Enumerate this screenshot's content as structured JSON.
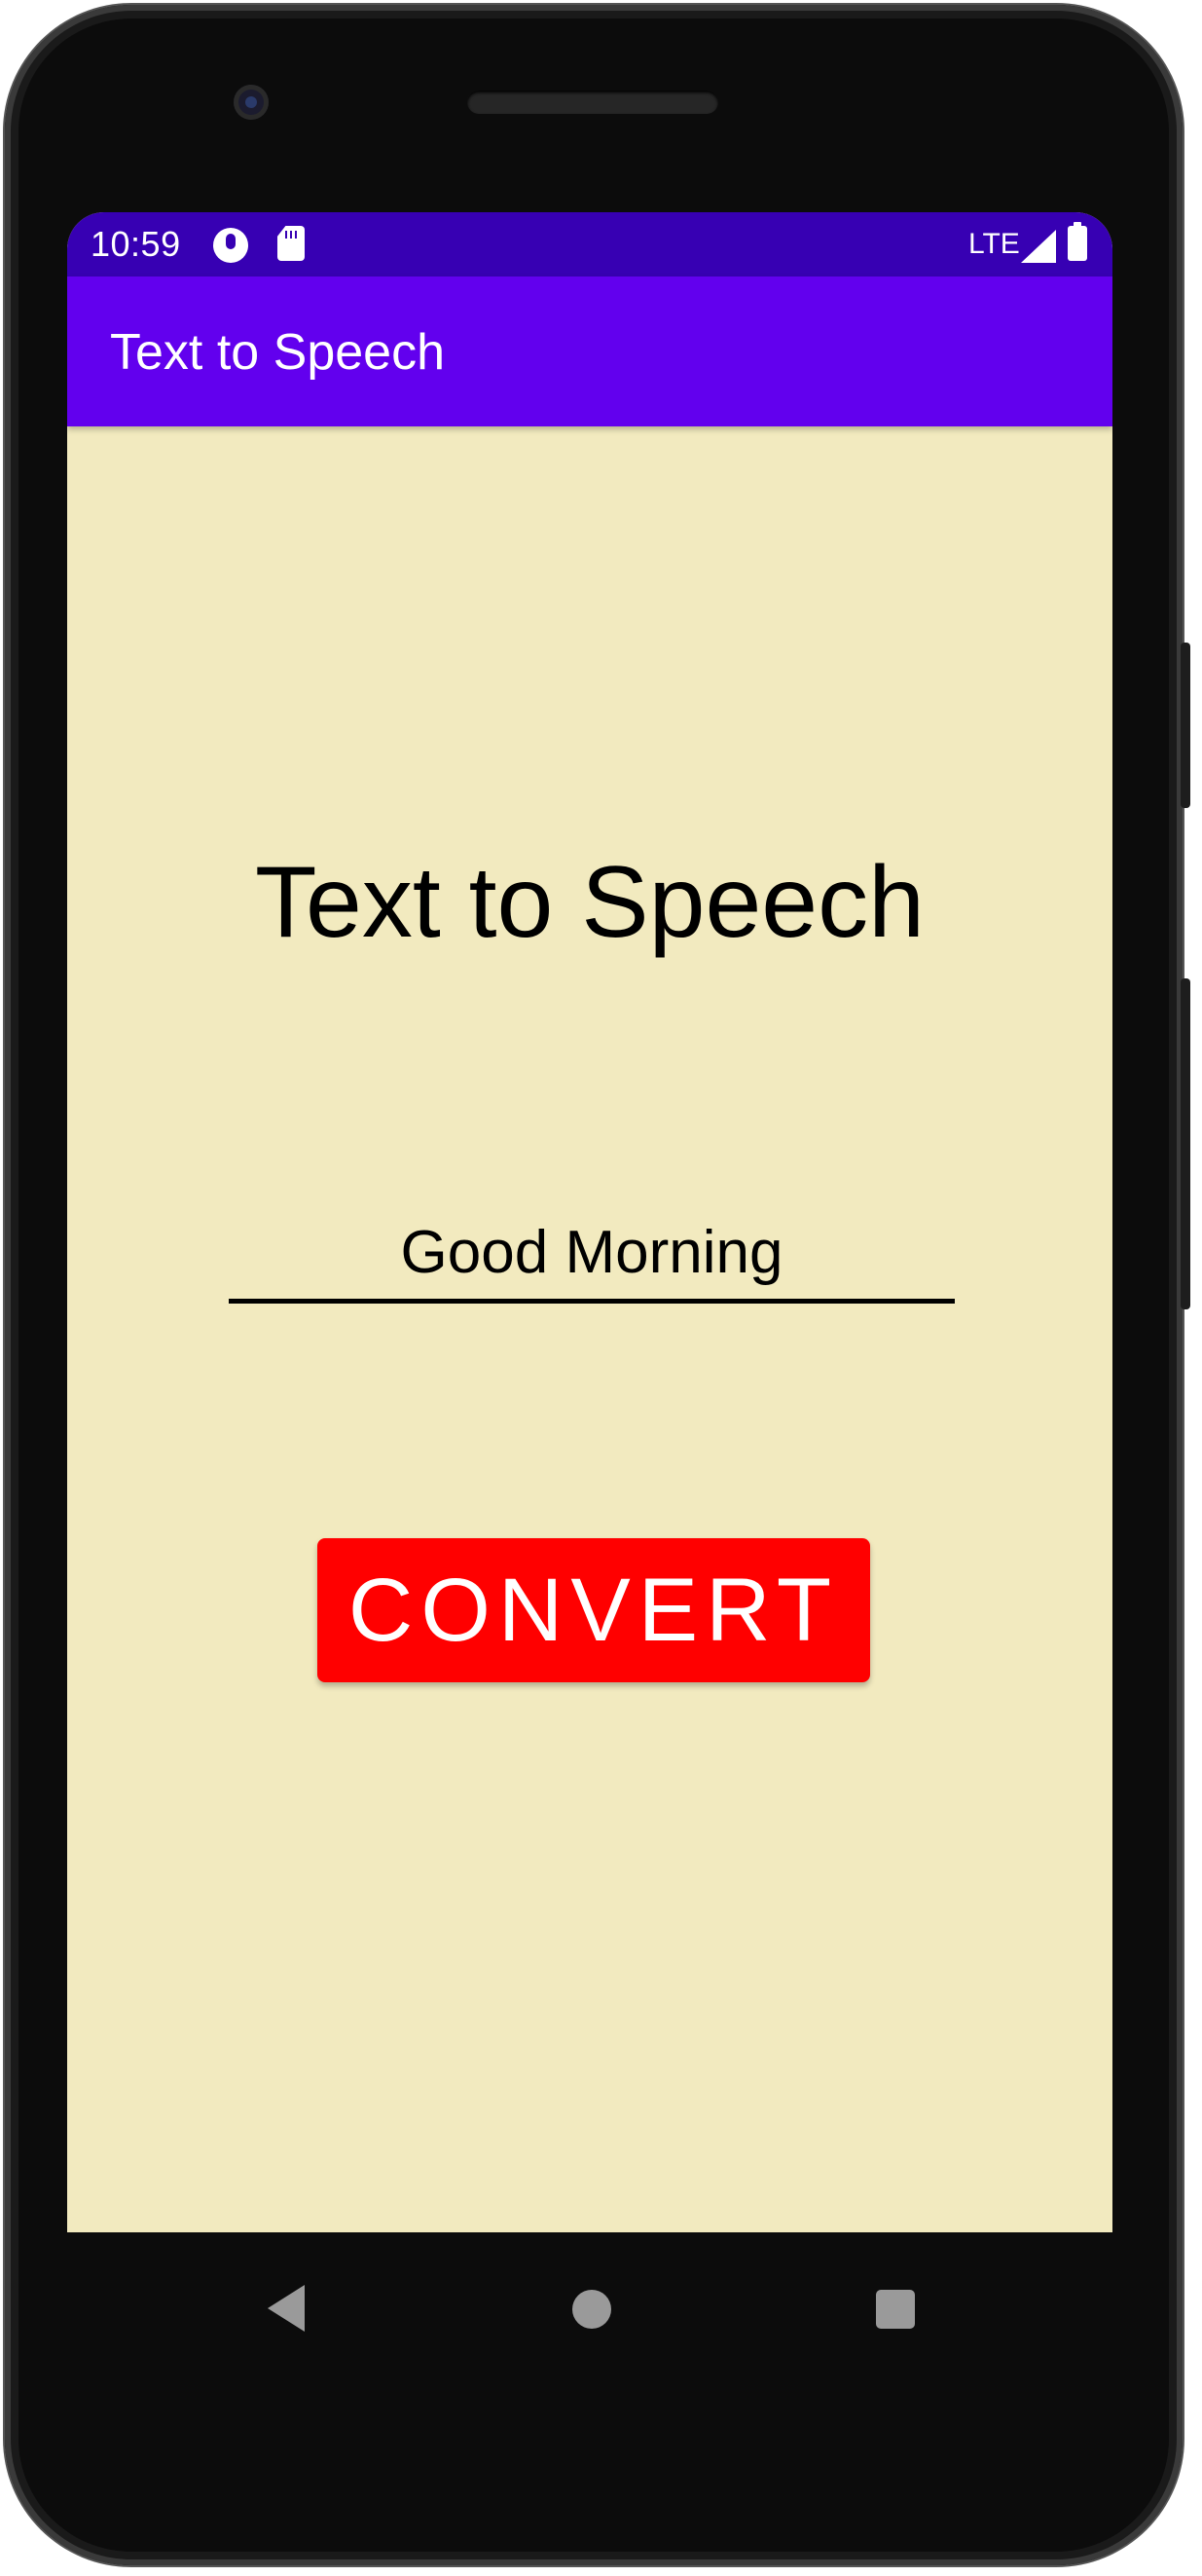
{
  "status_bar": {
    "time": "10:59",
    "network": "LTE",
    "icons": [
      "notification-icon",
      "sd-card-icon",
      "signal-icon",
      "battery-icon"
    ]
  },
  "app_bar": {
    "title": "Text to Speech",
    "color": "#6200ee"
  },
  "main": {
    "heading": "Text to Speech",
    "input_value": "Good Morning",
    "convert_label": "CONVERT",
    "background_color": "#f2eabf",
    "button_color": "#ff0000"
  },
  "nav_bar": {
    "icons": [
      "back-icon",
      "home-icon",
      "recent-apps-icon"
    ]
  }
}
